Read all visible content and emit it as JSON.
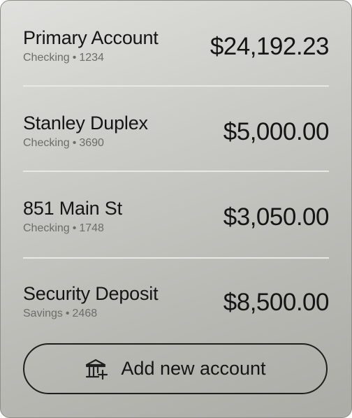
{
  "accounts": [
    {
      "name": "Primary Account",
      "type": "Checking",
      "number": "1234",
      "balance": "$24,192.23"
    },
    {
      "name": "Stanley Duplex",
      "type": "Checking",
      "number": "3690",
      "balance": "$5,000.00"
    },
    {
      "name": "851 Main St",
      "type": "Checking",
      "number": "1748",
      "balance": "$3,050.00"
    },
    {
      "name": "Security Deposit",
      "type": "Savings",
      "number": "2468",
      "balance": "$8,500.00"
    }
  ],
  "separator": "•",
  "add_button": {
    "label": "Add new account",
    "icon": "bank-add-icon"
  }
}
